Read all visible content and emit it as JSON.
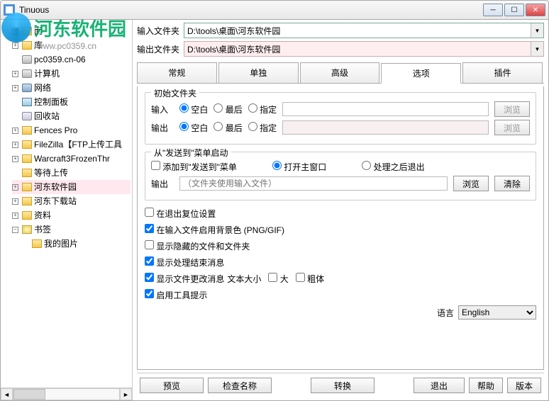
{
  "window": {
    "title": "Tinuous"
  },
  "watermark": {
    "text": "河东软件园",
    "url": "www.pc0359.cn"
  },
  "sidebar": {
    "items": [
      {
        "label": "面",
        "icon": "folder",
        "exp": "-"
      },
      {
        "label": "库",
        "icon": "folder",
        "exp": "+"
      },
      {
        "label": "pc0359.cn-06",
        "icon": "drive",
        "exp": ""
      },
      {
        "label": "计算机",
        "icon": "drive",
        "exp": "+"
      },
      {
        "label": "网络",
        "icon": "net",
        "exp": "+"
      },
      {
        "label": "控制面板",
        "icon": "cpl",
        "exp": ""
      },
      {
        "label": "回收站",
        "icon": "bin",
        "exp": ""
      },
      {
        "label": "Fences Pro",
        "icon": "folder",
        "exp": "+"
      },
      {
        "label": "FileZilla【FTP上传工具",
        "icon": "folder",
        "exp": "+"
      },
      {
        "label": "Warcraft3FrozenThr",
        "icon": "folder",
        "exp": "+"
      },
      {
        "label": "等待上传",
        "icon": "folder",
        "exp": ""
      },
      {
        "label": "河东软件园",
        "icon": "folder",
        "exp": "+",
        "hl": true
      },
      {
        "label": "河东下载站",
        "icon": "folder",
        "exp": "+"
      },
      {
        "label": "资料",
        "icon": "folder",
        "exp": "+"
      }
    ],
    "bookmarks": {
      "label": "书签",
      "exp": "-",
      "children": [
        {
          "label": "我的图片",
          "icon": "folder"
        }
      ]
    }
  },
  "paths": {
    "input_label": "输入文件夹",
    "output_label": "输出文件夹",
    "input_value": "D:\\tools\\桌面\\河东软件园",
    "output_value": "D:\\tools\\桌面\\河东软件园"
  },
  "tabs": {
    "items": [
      "常规",
      "单独",
      "高级",
      "选项",
      "插件"
    ],
    "active": 3
  },
  "options": {
    "group1_legend": "初始文件夹",
    "input_label": "输入",
    "output_label": "输出",
    "radio_blank": "空白",
    "radio_last": "最后",
    "radio_spec": "指定",
    "browse": "浏览",
    "group2_legend": "从\"发送到\"菜单启动",
    "add_sendto": "添加到\"发送到\"菜单",
    "open_main": "打开主窗口",
    "exit_after": "处理之后退出",
    "output_row_label": "输出",
    "output_placeholder": "（文件夹使用输入文件）",
    "clear": "清除",
    "reset_on_exit": "在退出复位设置",
    "bg_color": "在输入文件启用背景色 (PNG/GIF)",
    "show_hidden": "显示隐藏的文件和文件夹",
    "show_proc_msg": "显示处理结束消息",
    "show_change_msg": "显示文件更改消息",
    "enable_tips": "启用工具提示",
    "text_size": "文本大小",
    "large": "大",
    "bold": "粗体",
    "language_label": "语言",
    "language_value": "English"
  },
  "bottom": {
    "preview": "预览",
    "check_name": "检查名称",
    "convert": "转换",
    "exit": "退出",
    "help": "帮助",
    "version": "版本"
  }
}
